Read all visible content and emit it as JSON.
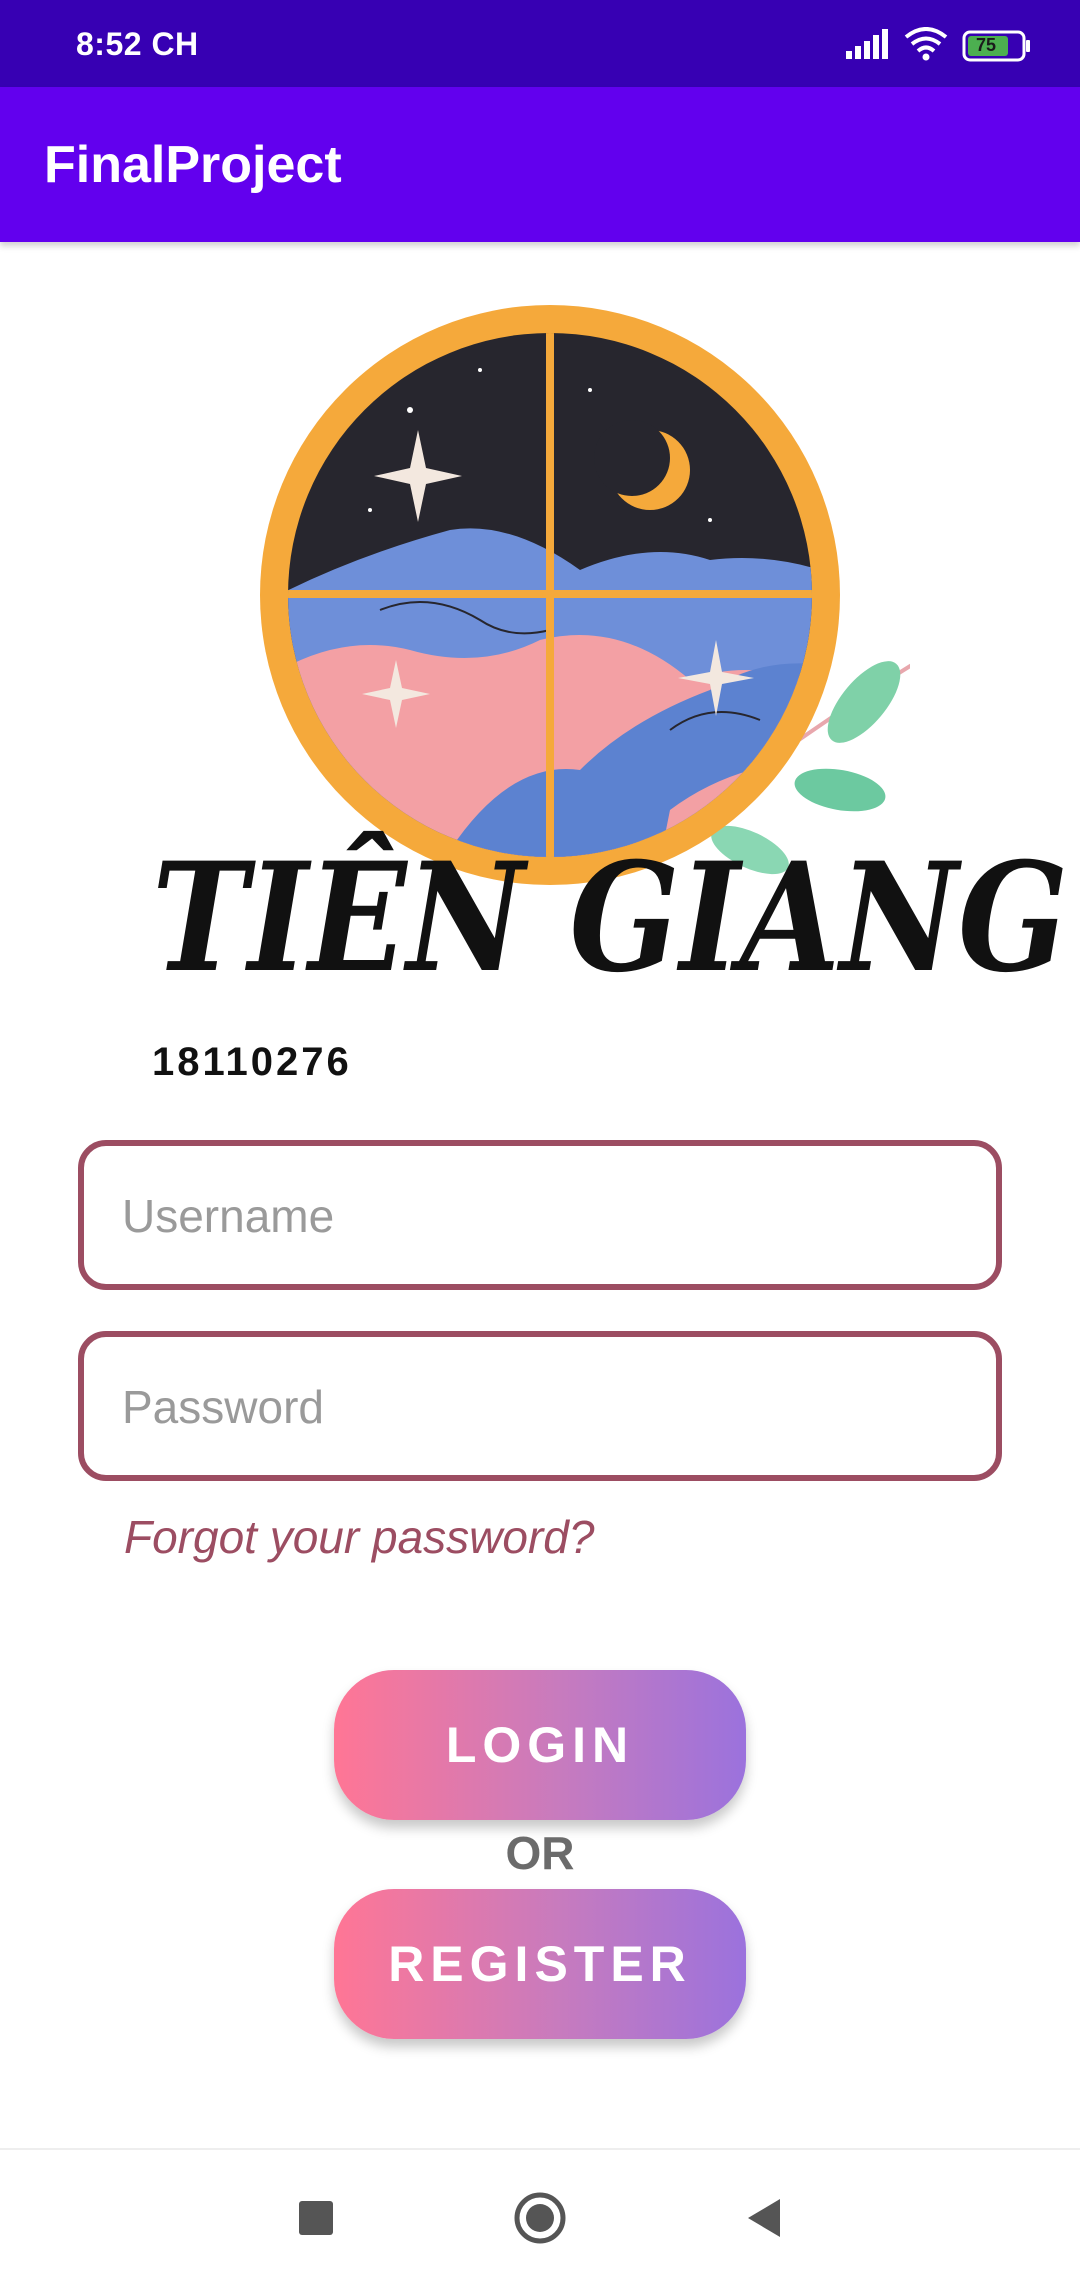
{
  "status_bar": {
    "time": "8:52 CH",
    "battery": "75"
  },
  "app_bar": {
    "title": "FinalProject"
  },
  "logo": {
    "text": "TIÊN GIANG",
    "student_id": "18110276"
  },
  "form": {
    "username_placeholder": "Username",
    "password_placeholder": "Password",
    "forgot_label": "Forgot your password?",
    "login_label": "LOGIN",
    "or_label": "OR",
    "register_label": "REGISTER"
  },
  "colors": {
    "status_bar": "#3700b3",
    "app_bar": "#6200ee",
    "field_border": "#9c4d62",
    "button_gradient_start": "#ff7695",
    "button_gradient_end": "#9b72dd"
  },
  "nav_bar": {
    "icons": [
      "recents-icon",
      "home-icon",
      "back-icon"
    ]
  }
}
